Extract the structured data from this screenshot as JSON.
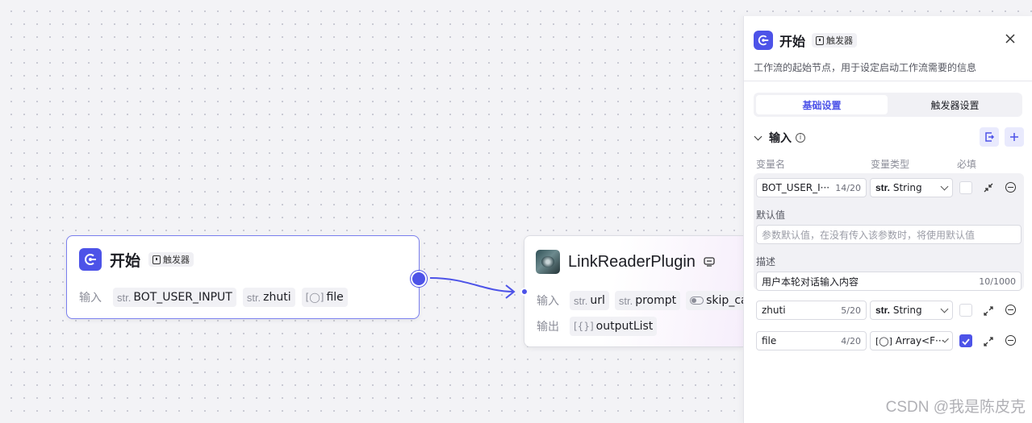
{
  "canvas": {
    "start_node": {
      "title": "开始",
      "badge": "触发器",
      "input_label": "输入",
      "inputs": [
        {
          "type": "str.",
          "name": "BOT_USER_INPUT"
        },
        {
          "type": "str.",
          "name": "zhuti"
        },
        {
          "type": "[◯]",
          "name": "file"
        }
      ]
    },
    "plugin_node": {
      "title": "LinkReaderPlugin",
      "input_label": "输入",
      "output_label": "输出",
      "inputs": [
        {
          "type": "str.",
          "name": "url"
        },
        {
          "type": "str.",
          "name": "prompt"
        },
        {
          "type": "toggle",
          "name": "skip_ca"
        }
      ],
      "outputs": [
        {
          "type": "[{}]",
          "name": "outputList"
        }
      ]
    }
  },
  "panel": {
    "title": "开始",
    "badge": "触发器",
    "description": "工作流的起始节点，用于设定启动工作流需要的信息",
    "tabs": [
      {
        "label": "基础设置",
        "active": true
      },
      {
        "label": "触发器设置",
        "active": false
      }
    ],
    "section_title": "输入",
    "columns": {
      "name": "变量名",
      "type": "变量类型",
      "required": "必填"
    },
    "variables": [
      {
        "name": "BOT_USER_I···",
        "count": "14/20",
        "type_prefix": "str.",
        "type": "String",
        "required": false
      },
      {
        "name": "zhuti",
        "count": "5/20",
        "type_prefix": "str.",
        "type": "String",
        "required": false
      },
      {
        "name": "file",
        "count": "4/20",
        "type_prefix": "[◯]",
        "type": "Array<F···",
        "required": true
      }
    ],
    "default_label": "默认值",
    "default_placeholder": "参数默认值，在没有传入该参数时，将使用默认值",
    "desc_label": "描述",
    "desc_value": "用户本轮对话输入内容",
    "desc_count": "10/1000"
  },
  "watermark": "CSDN @我是陈皮克",
  "colors": {
    "accent": "#4d53e8",
    "edge": "#4d53e8"
  }
}
